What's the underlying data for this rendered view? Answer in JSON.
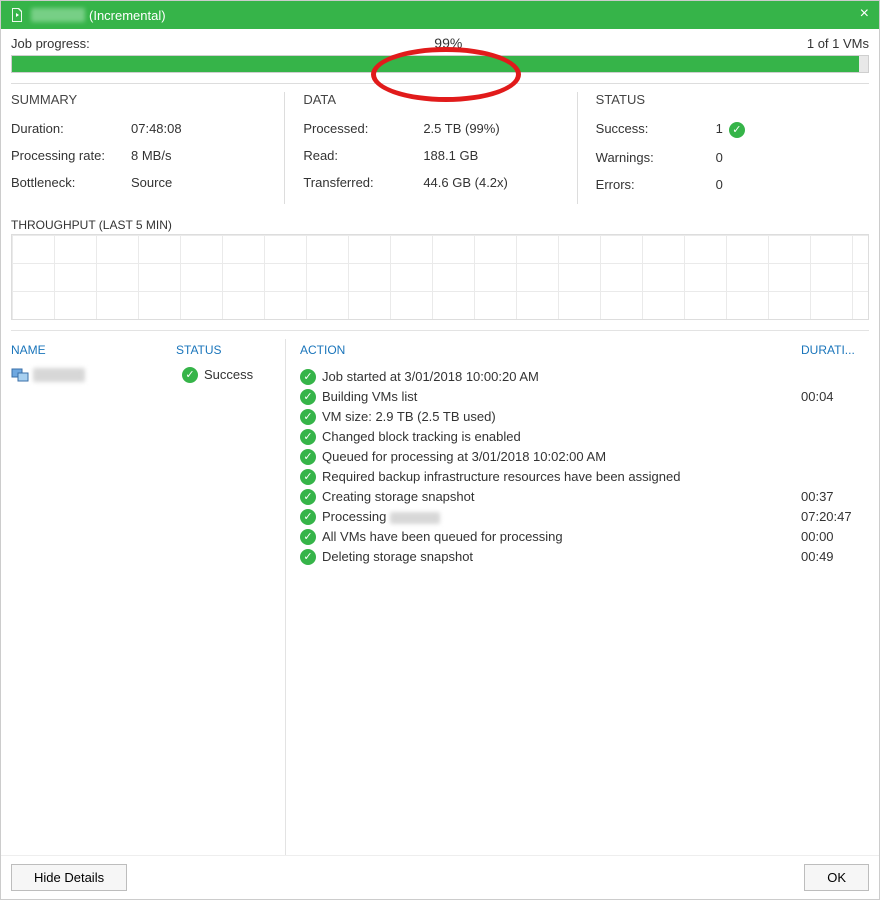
{
  "title": {
    "suffix": "(Incremental)"
  },
  "progress": {
    "label": "Job progress:",
    "percent_text": "99%",
    "percent_value": 99,
    "vm_count": "1 of 1 VMs"
  },
  "summary": {
    "heading": "SUMMARY",
    "rows": [
      {
        "k": "Duration:",
        "v": "07:48:08"
      },
      {
        "k": "Processing rate:",
        "v": "8 MB/s"
      },
      {
        "k": "Bottleneck:",
        "v": "Source"
      }
    ]
  },
  "data": {
    "heading": "DATA",
    "rows": [
      {
        "k": "Processed:",
        "v": "2.5 TB (99%)"
      },
      {
        "k": "Read:",
        "v": "188.1 GB"
      },
      {
        "k": "Transferred:",
        "v": "44.6 GB (4.2x)"
      }
    ]
  },
  "status": {
    "heading": "STATUS",
    "rows": [
      {
        "k": "Success:",
        "v": "1",
        "check": true
      },
      {
        "k": "Warnings:",
        "v": "0"
      },
      {
        "k": "Errors:",
        "v": "0"
      }
    ]
  },
  "throughput": {
    "title": "THROUGHPUT (LAST 5 MIN)"
  },
  "headers": {
    "name": "NAME",
    "status": "STATUS",
    "action": "ACTION",
    "duration": "DURATI..."
  },
  "vm": {
    "status": "Success"
  },
  "actions": [
    {
      "text": "Job started at 3/01/2018 10:00:20 AM",
      "dur": ""
    },
    {
      "text": "Building VMs list",
      "dur": "00:04"
    },
    {
      "text": "VM size: 2.9 TB (2.5 TB used)",
      "dur": ""
    },
    {
      "text": "Changed block tracking is enabled",
      "dur": ""
    },
    {
      "text": "Queued for processing at 3/01/2018 10:02:00 AM",
      "dur": ""
    },
    {
      "text": "Required backup infrastructure resources have been assigned",
      "dur": ""
    },
    {
      "text": "Creating storage snapshot",
      "dur": "00:37"
    },
    {
      "text": "Processing ",
      "dur": "07:20:47",
      "blurred": true
    },
    {
      "text": "All VMs have been queued for processing",
      "dur": "00:00"
    },
    {
      "text": "Deleting storage snapshot",
      "dur": "00:49"
    }
  ],
  "footer": {
    "hide": "Hide Details",
    "ok": "OK"
  },
  "colors": {
    "green": "#36b449",
    "link": "#1a75bb",
    "red": "#e11b1b"
  },
  "chart_data": {
    "type": "line",
    "title": "THROUGHPUT (LAST 5 MIN)",
    "xlabel": "",
    "ylabel": "",
    "x": [],
    "values": [],
    "note": "chart area is empty/blank in screenshot"
  }
}
